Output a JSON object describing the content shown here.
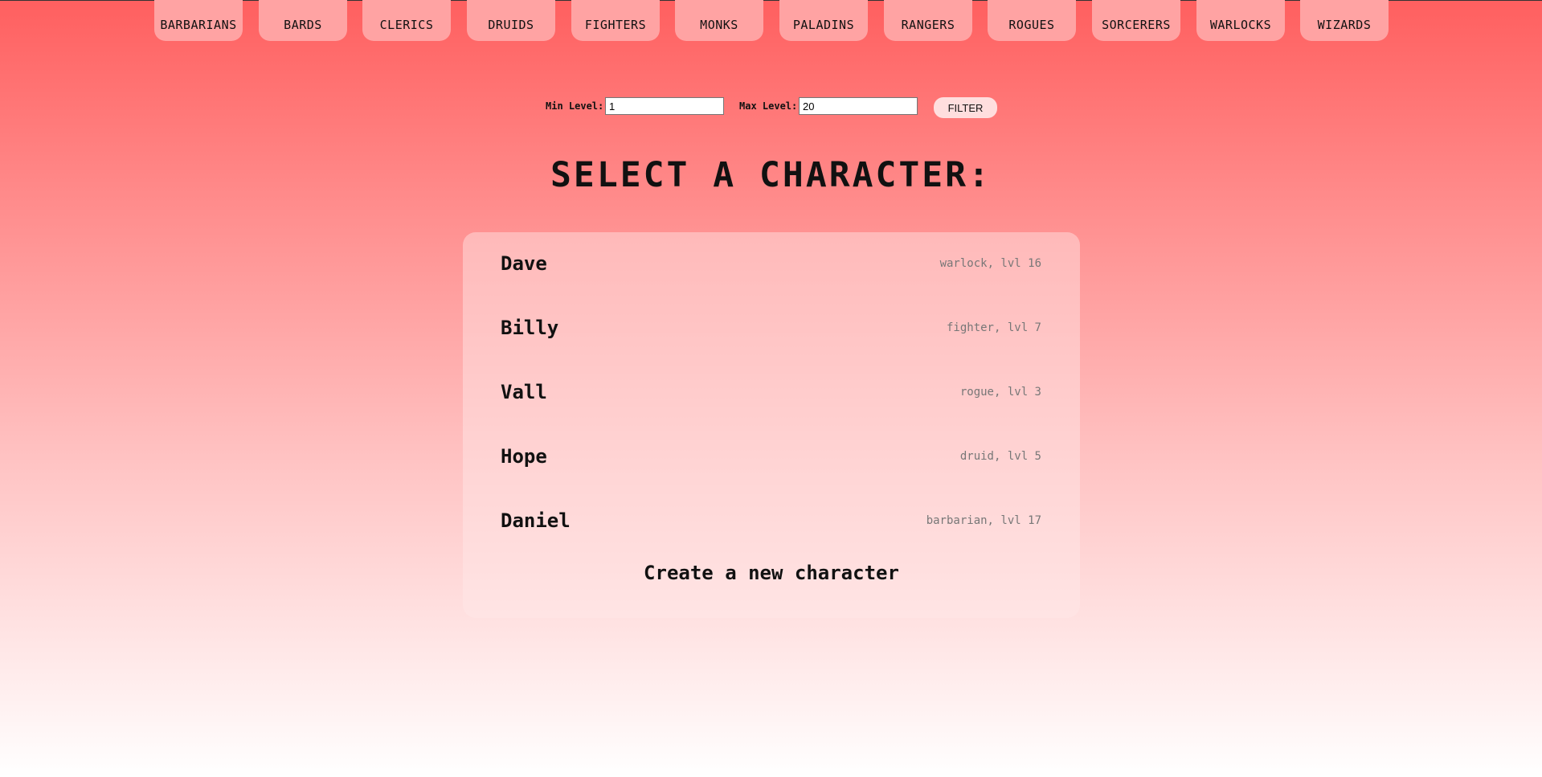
{
  "nav": {
    "classes": [
      "BARBARIANS",
      "BARDS",
      "CLERICS",
      "DRUIDS",
      "FIGHTERS",
      "MONKS",
      "PALADINS",
      "RANGERS",
      "ROGUES",
      "SORCERERS",
      "WARLOCKS",
      "WIZARDS"
    ]
  },
  "filter": {
    "min_label": "Min Level:",
    "min_value": "1",
    "max_label": "Max Level:",
    "max_value": "20",
    "button_label": "FILTER"
  },
  "title": "SELECT A CHARACTER:",
  "characters": [
    {
      "name": "Dave",
      "meta": "warlock, lvl 16"
    },
    {
      "name": "Billy",
      "meta": "fighter, lvl 7"
    },
    {
      "name": "Vall",
      "meta": "rogue, lvl 3"
    },
    {
      "name": "Hope",
      "meta": "druid, lvl 5"
    },
    {
      "name": "Daniel",
      "meta": "barbarian, lvl 17"
    }
  ],
  "create_label": "Create a new character",
  "colors": {
    "accent": "#ff5f5f",
    "tab": "#ffa3a3"
  }
}
